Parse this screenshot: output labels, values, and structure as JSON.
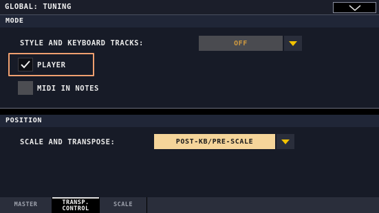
{
  "header": {
    "title": "GLOBAL: TUNING",
    "menu_icon": "chevron-down-icon"
  },
  "mode": {
    "section_label": "MODE",
    "style_tracks": {
      "label": "STYLE AND KEYBOARD TRACKS:",
      "value": "OFF"
    },
    "player": {
      "label": "PLAYER",
      "checked": true
    },
    "midi_in_notes": {
      "label": "MIDI IN NOTES",
      "checked": false
    }
  },
  "position": {
    "section_label": "POSITION",
    "scale_transpose": {
      "label": "SCALE AND TRANSPOSE:",
      "value": "POST-KB/PRE-SCALE"
    }
  },
  "tabs": [
    {
      "label": "MASTER",
      "active": false
    },
    {
      "label_line1": "TRANSP.",
      "label_line2": "CONTROL",
      "active": true
    },
    {
      "label": "SCALE",
      "active": false
    }
  ],
  "colors": {
    "accent": "#f5d59a",
    "accent_text": "#1a1a1a",
    "disabled_field": "#4a4b50",
    "disabled_text": "#d09a40",
    "arrow": "#f2c200",
    "highlight": "#f0a070"
  }
}
